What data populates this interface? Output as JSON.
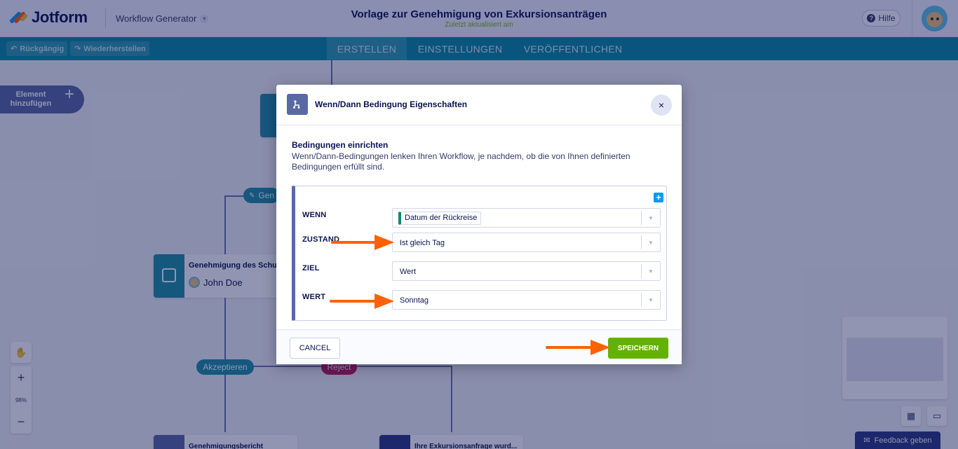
{
  "header": {
    "brand": "Jotform",
    "workflow_generator": "Workflow Generator",
    "title": "Vorlage zur Genehmigung von Exkursionsanträgen",
    "subtitle": "Zuletzt aktualisiert am",
    "help": "Hilfe"
  },
  "toolbar": {
    "undo": "Rückgängig",
    "redo": "Wiederherstellen",
    "tabs": [
      "ERSTELLEN",
      "EINSTELLUNGEN",
      "VERÖFFENTLICHEN"
    ],
    "active_tab": "ERSTELLEN"
  },
  "canvas": {
    "add_element": "Element hinzufügen",
    "node_approval_title": "Genehmigung des Schulle",
    "node_approval_person": "John Doe",
    "pill_partial": "Gen",
    "pill_accept": "Akzeptieren",
    "pill_reject": "Reject",
    "node_report": "Genehmigungsbericht",
    "node_request": "Ihre Exkursionsanfrage wurd...",
    "zoom_level": "98%",
    "feedback": "Feedback geben"
  },
  "modal": {
    "title": "Wenn/Dann Bedingung Eigenschaften",
    "section_title": "Bedingungen einrichten",
    "description": "Wenn/Dann-Bedingungen lenken Ihren Workflow, je nachdem, ob die von Ihnen definierten Bedingungen erfüllt sind.",
    "rows": {
      "wenn": {
        "label": "WENN",
        "value": "Datum der Rückreise"
      },
      "zustand": {
        "label": "ZUSTAND",
        "value": "Ist gleich Tag"
      },
      "ziel": {
        "label": "ZIEL",
        "value": "Wert"
      },
      "wert": {
        "label": "WERT",
        "value": "Sonntag"
      }
    },
    "cancel": "CANCEL",
    "save": "SPEICHERN",
    "close": "×"
  },
  "colors": {
    "teal": "#0a8aa0",
    "save_green": "#64b200",
    "annotation_arrow": "#ff6100",
    "accept_pill": "#1f8fa3",
    "reject_pill": "#c2185b"
  }
}
